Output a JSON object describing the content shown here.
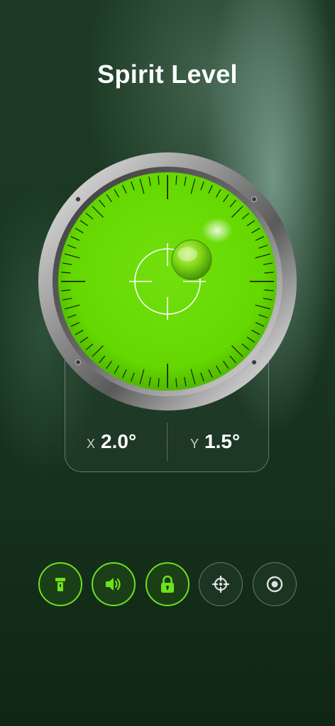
{
  "header": {
    "title": "Spirit Level"
  },
  "readout": {
    "x_label": "X",
    "x_value": "2.0°",
    "y_label": "Y",
    "y_value": "1.5°"
  },
  "level": {
    "x_deg": 2.0,
    "y_deg": 1.5
  },
  "controls": [
    {
      "name": "flashlight",
      "icon": "flashlight-icon",
      "active": true
    },
    {
      "name": "sound",
      "icon": "speaker-icon",
      "active": true
    },
    {
      "name": "lock",
      "icon": "lock-icon",
      "active": true
    },
    {
      "name": "calibrate",
      "icon": "crosshair-icon",
      "active": false
    },
    {
      "name": "surface-mode",
      "icon": "circle-dot-icon",
      "active": false
    }
  ],
  "colors": {
    "accent": "#6ee21a",
    "vial": "#66dd00",
    "background": "#1a3822"
  }
}
